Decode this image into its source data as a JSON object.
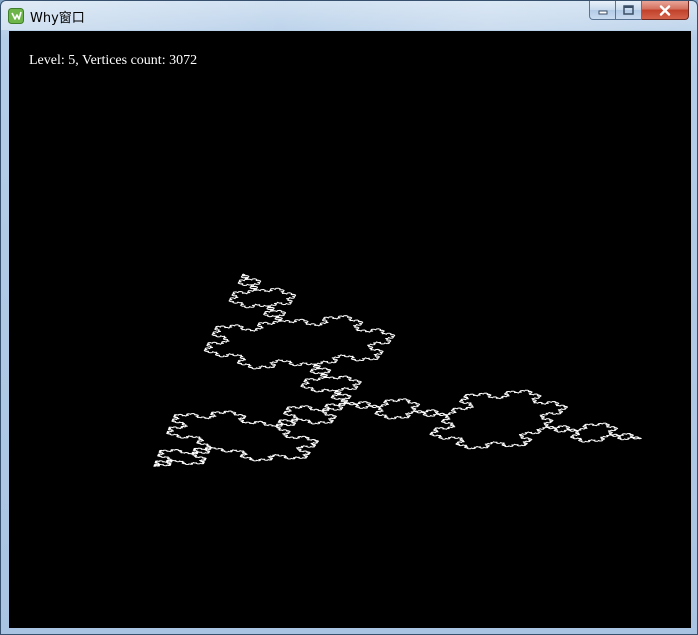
{
  "window": {
    "title": "Why窗口",
    "accent": "#7ec35a"
  },
  "titlebar": {
    "controls": {
      "minimize": "minimize-icon",
      "maximize": "maximize-icon",
      "close": "close-icon"
    }
  },
  "hud": {
    "text": "Level: 5, Vertices count: 3072"
  },
  "render": {
    "background": "#000000",
    "stroke": "#ffffff",
    "subject": "3D Koch snowflake fractal"
  }
}
